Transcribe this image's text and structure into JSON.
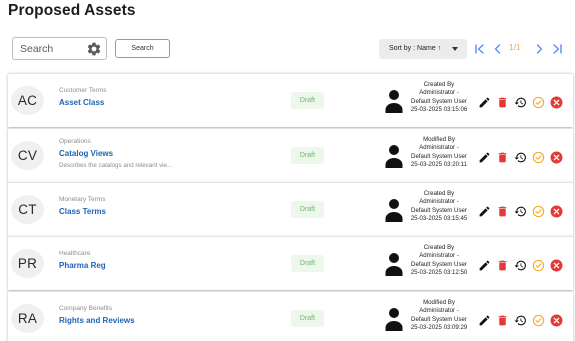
{
  "page": {
    "title": "Proposed Assets"
  },
  "toolbar": {
    "search_placeholder": "Search",
    "search_button_label": "Search",
    "sort_label": "Sort by : Name ↑",
    "pagination": {
      "current": "1",
      "separator": "/",
      "total": "1"
    }
  },
  "assets": [
    {
      "initials": "AC",
      "category": "Customer Terms",
      "name": "Asset Class",
      "description": "",
      "status": "Draft",
      "audit_action": "Created By",
      "audit_user_line1": "Administrator -",
      "audit_user_line2": "Default System User",
      "audit_timestamp": "25-03-2025 03:15:06"
    },
    {
      "initials": "CV",
      "category": "Operations",
      "name": "Catalog Views",
      "description": "Describes the catalogs and relevant vie...",
      "status": "Draft",
      "audit_action": "Modified By",
      "audit_user_line1": "Administrator -",
      "audit_user_line2": "Default System User",
      "audit_timestamp": "25-03-2025 03:20:11"
    },
    {
      "initials": "CT",
      "category": "Monetary Terms",
      "name": "Class Terms",
      "description": "",
      "status": "Draft",
      "audit_action": "Created By",
      "audit_user_line1": "Administrator -",
      "audit_user_line2": "Default System User",
      "audit_timestamp": "25-03-2025 03:15:45"
    },
    {
      "initials": "PR",
      "category": "Healthcare",
      "name": "Pharma Reg",
      "description": "",
      "status": "Draft",
      "audit_action": "Created By",
      "audit_user_line1": "Administrator -",
      "audit_user_line2": "Default System User",
      "audit_timestamp": "25-03-2025 03:12:50"
    },
    {
      "initials": "RA",
      "category": "Company Benefits",
      "name": "Rights and Reviews",
      "description": "",
      "status": "Draft",
      "audit_action": "Modified By",
      "audit_user_line1": "Administrator -",
      "audit_user_line2": "Default System User",
      "audit_timestamp": "25-03-2025 03:09:29"
    }
  ],
  "icons": {
    "settings": "gear-icon",
    "first_page": "first-page-icon",
    "prev_page": "chevron-left-icon",
    "next_page": "chevron-right-icon",
    "last_page": "last-page-icon",
    "user": "person-icon",
    "edit": "pencil-icon",
    "delete": "trash-icon",
    "history": "history-icon",
    "approve": "check-circle-icon",
    "reject": "close-circle-icon"
  },
  "colors": {
    "link": "#1e64b4",
    "pager_accent": "#5a8ff2",
    "draft_text": "#6fb76c",
    "draft_bg": "#eef7ec",
    "delete": "#e53935",
    "approve": "#f5a623",
    "reject": "#e53935"
  }
}
